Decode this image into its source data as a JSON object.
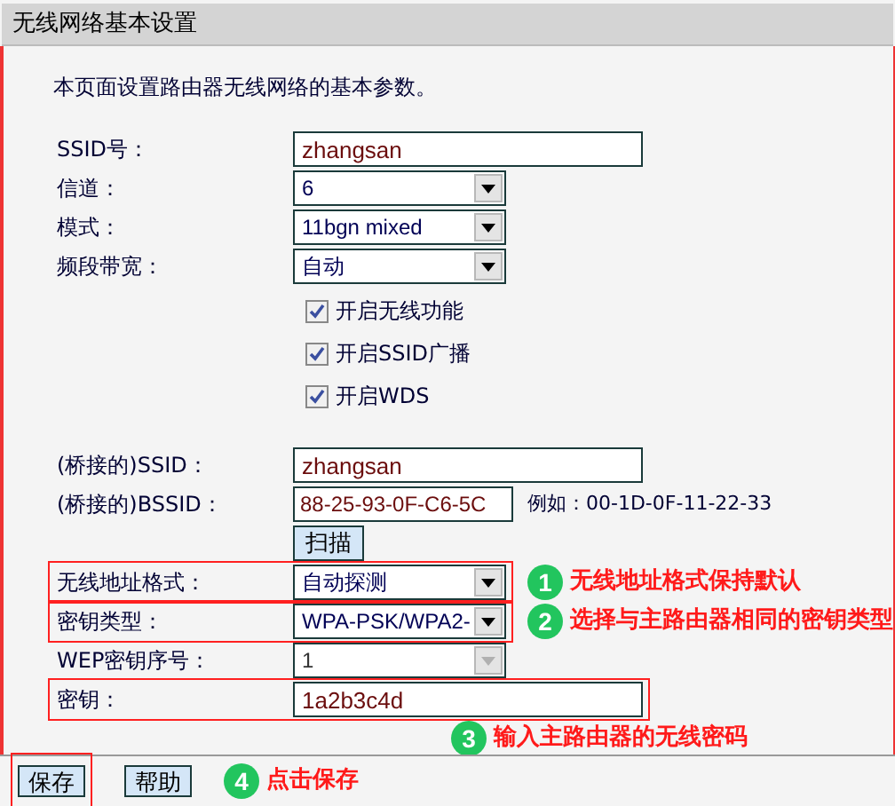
{
  "title": "无线网络基本设置",
  "description": "本页面设置路由器无线网络的基本参数。",
  "basic_fields": [
    {
      "kind": "input",
      "label": "SSID号：",
      "value": "zhangsan"
    },
    {
      "kind": "select",
      "label": "信道：",
      "value": "6",
      "disabled": false
    },
    {
      "kind": "select",
      "label": "模式：",
      "value": "11bgn mixed",
      "disabled": false
    },
    {
      "kind": "select",
      "label": "频段带宽：",
      "value": "自动",
      "disabled": false
    }
  ],
  "checkboxes": [
    {
      "label": "开启无线功能",
      "checked": true
    },
    {
      "label": "开启SSID广播",
      "checked": true
    },
    {
      "label": "开启WDS",
      "checked": true
    }
  ],
  "bridge_fields": [
    {
      "kind": "input",
      "label": "(桥接的)SSID：",
      "value": "zhangsan",
      "annotated": false
    },
    {
      "kind": "short_input",
      "label": "(桥接的)BSSID：",
      "value": "88-25-93-0F-C6-5C",
      "hint": "例如：00-1D-0F-11-22-33",
      "annotated": false
    },
    {
      "kind": "button",
      "label": "扫描",
      "annotated": false
    },
    {
      "kind": "select",
      "label": "无线地址格式：",
      "value": "自动探测",
      "disabled": false,
      "annotated": true,
      "note": {
        "kind": "right",
        "number": "1",
        "text": "无线地址格式保持默认"
      }
    },
    {
      "kind": "select",
      "label": "密钥类型：",
      "value": "WPA-PSK/WPA2-",
      "disabled": false,
      "annotated": true,
      "note": {
        "kind": "right",
        "number": "2",
        "text": "选择与主路由器相同的密钥类型"
      }
    },
    {
      "kind": "select",
      "label": "WEP密钥序号：",
      "value": "1",
      "disabled": true,
      "annotated": false
    },
    {
      "kind": "input",
      "label": "密钥：",
      "value": "1a2b3c4d",
      "annotated": true,
      "note": {
        "kind": "below",
        "number": "3",
        "text": "输入主路由器的无线密码"
      }
    }
  ],
  "footer": {
    "buttons": [
      {
        "label": "保存",
        "annotated": true
      },
      {
        "label": "帮助",
        "annotated": false
      }
    ],
    "note": {
      "number": "4",
      "text": "点击保存"
    }
  }
}
